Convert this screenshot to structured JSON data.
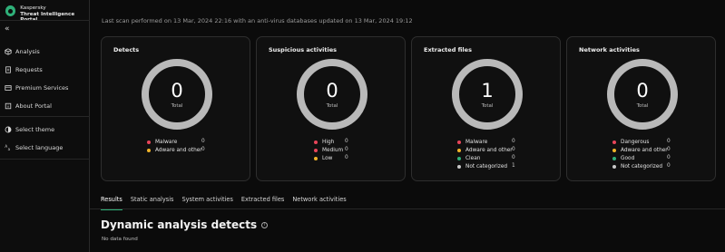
{
  "brand": {
    "name": "Kaspersky",
    "product": "Threat Intelligence Portal"
  },
  "sidebar": {
    "collapse_icon": "«",
    "items": [
      {
        "label": "Analysis",
        "icon": "cube-icon"
      },
      {
        "label": "Requests",
        "icon": "document-icon"
      },
      {
        "label": "Premium Services",
        "icon": "card-icon"
      },
      {
        "label": "About Portal",
        "icon": "info-icon"
      }
    ],
    "settings": [
      {
        "label": "Select theme",
        "icon": "theme-icon"
      },
      {
        "label": "Select language",
        "icon": "language-icon"
      }
    ]
  },
  "scan_info": "Last scan performed on 13 Mar, 2024 22:16 with an anti-virus databases updated on 13 Mar, 2024 19:12",
  "cards": [
    {
      "title": "Detects",
      "total": "0",
      "total_label": "Total",
      "legend": [
        {
          "label": "Malware",
          "value": "0",
          "color": "#e8455a"
        },
        {
          "label": "Adware and other",
          "value": "0",
          "color": "#f0b429"
        }
      ]
    },
    {
      "title": "Suspicious activities",
      "total": "0",
      "total_label": "Total",
      "legend": [
        {
          "label": "High",
          "value": "0",
          "color": "#e8455a"
        },
        {
          "label": "Medium",
          "value": "0",
          "color": "#e8455a"
        },
        {
          "label": "Low",
          "value": "0",
          "color": "#f0b429"
        }
      ]
    },
    {
      "title": "Extracted files",
      "total": "1",
      "total_label": "Total",
      "legend": [
        {
          "label": "Malware",
          "value": "0",
          "color": "#e8455a"
        },
        {
          "label": "Adware and other",
          "value": "0",
          "color": "#f0b429"
        },
        {
          "label": "Clean",
          "value": "0",
          "color": "#2fb079"
        },
        {
          "label": "Not categorized",
          "value": "1",
          "color": "#c8c8c8"
        }
      ]
    },
    {
      "title": "Network activities",
      "total": "0",
      "total_label": "Total",
      "legend": [
        {
          "label": "Dangerous",
          "value": "0",
          "color": "#e8455a"
        },
        {
          "label": "Adware and other",
          "value": "0",
          "color": "#f0b429"
        },
        {
          "label": "Good",
          "value": "0",
          "color": "#2fb079"
        },
        {
          "label": "Not categorized",
          "value": "0",
          "color": "#c8c8c8"
        }
      ]
    }
  ],
  "tabs": [
    {
      "label": "Results",
      "active": true
    },
    {
      "label": "Static analysis",
      "active": false
    },
    {
      "label": "System activities",
      "active": false
    },
    {
      "label": "Extracted files",
      "active": false
    },
    {
      "label": "Network activities",
      "active": false
    }
  ],
  "section": {
    "title": "Dynamic analysis detects",
    "info_icon": "i",
    "empty": "No data found"
  }
}
